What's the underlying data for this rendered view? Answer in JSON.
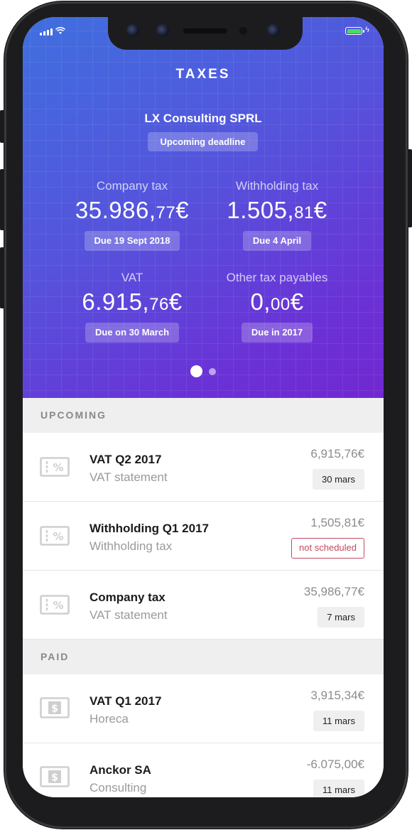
{
  "header": {
    "title": "TAXES",
    "company": "LX Consulting SPRL",
    "badge": "Upcoming deadline"
  },
  "taxes": [
    {
      "label": "Company tax",
      "amount_main": "35.986,",
      "amount_small": "77",
      "currency": "€",
      "due": "Due 19 Sept 2018"
    },
    {
      "label": "Withholding tax",
      "amount_main": "1.505,",
      "amount_small": "81",
      "currency": "€",
      "due": "Due 4 April"
    },
    {
      "label": "VAT",
      "amount_main": "6.915,",
      "amount_small": "76",
      "currency": "€",
      "due": "Due on 30 March"
    },
    {
      "label": "Other tax payables",
      "amount_main": "0,",
      "amount_small": "00",
      "currency": "€",
      "due": "Due in 2017"
    }
  ],
  "pager": {
    "pages": 2,
    "active": 1
  },
  "sections": {
    "upcoming": {
      "title": "UPCOMING",
      "items": [
        {
          "name": "VAT Q2 2017",
          "sub": "VAT statement",
          "value": "6,915,76€",
          "tag": "30 mars",
          "icon": "tax-ticket-icon"
        },
        {
          "name": "Withholding Q1 2017",
          "sub": "Withholding tax",
          "value": "1,505,81€",
          "tag": "not scheduled",
          "icon": "tax-ticket-icon"
        },
        {
          "name": "Company tax",
          "sub": "VAT statement",
          "value": "35,986,77€",
          "tag": "7 mars",
          "icon": "tax-ticket-icon"
        }
      ]
    },
    "paid": {
      "title": "PAID",
      "items": [
        {
          "name": "VAT Q1 2017",
          "sub": "Horeca",
          "value": "3,915,34€",
          "tag": "11 mars",
          "icon": "dollar-bill-icon"
        },
        {
          "name": "Anckor SA",
          "sub": "Consulting",
          "value": "-6.075,00€",
          "tag": "11 mars",
          "icon": "dollar-bill-icon"
        }
      ]
    }
  },
  "colors": {
    "accent_start": "#3f6fdf",
    "accent_end": "#7227d1",
    "warning": "#c14a60",
    "battery": "#4cd964"
  }
}
